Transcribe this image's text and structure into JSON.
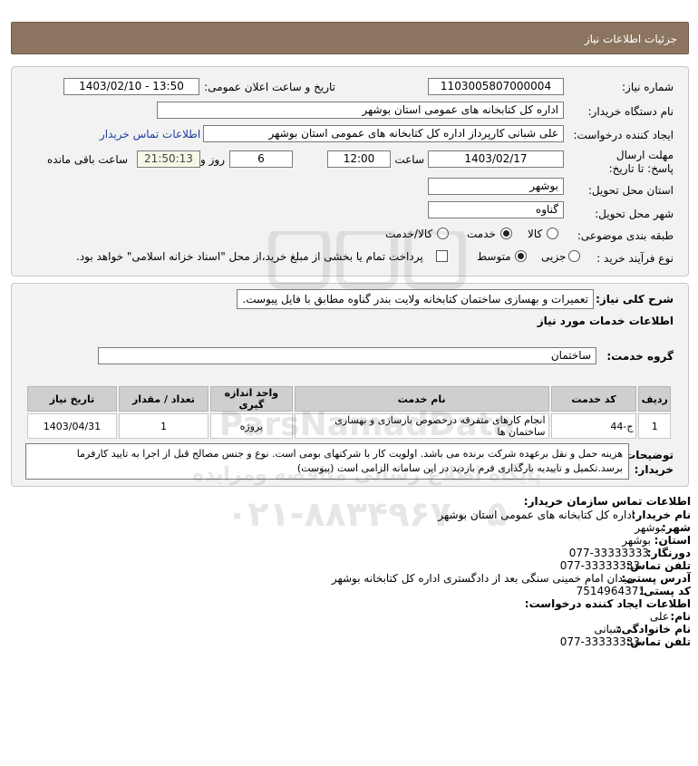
{
  "header": {
    "title": "جزئیات اطلاعات نیاز"
  },
  "form": {
    "need_number_label": "شماره نیاز:",
    "need_number": "1103005807000004",
    "announce_label": "تاریخ و ساعت اعلان عمومی:",
    "announce_value": "1403/02/10 - 13:50",
    "buyer_org_label": "نام دستگاه خریدار:",
    "buyer_org": "اداره کل کتابخانه های عمومی استان بوشهر",
    "creator_label": "ایجاد کننده درخواست:",
    "creator": "علی شبانی کارپرداز اداره کل کتابخانه های عمومی استان بوشهر",
    "contact_link": "اطلاعات تماس خریدار",
    "deadline_label": "مهلت ارسال پاسخ: تا تاریخ:",
    "deadline_date": "1403/02/17",
    "time_label": "ساعت",
    "deadline_time": "12:00",
    "days_value": "6",
    "days_label": "روز و",
    "remaining_time": "21:50:13",
    "remaining_label": "ساعت باقی مانده",
    "province_label": "استان محل تحویل:",
    "province": "بوشهر",
    "city_label": "شهر محل تحویل:",
    "city": "گناوه",
    "category_label": "طبقه بندی موضوعی:",
    "category_options": [
      "کالا",
      "خدمت",
      "کالا/خدمت"
    ],
    "category_selected": "خدمت",
    "process_label": "نوع فرآیند خرید :",
    "process_options": [
      "جزیی",
      "متوسط"
    ],
    "process_selected": "متوسط",
    "payment_note": "پرداخت تمام یا بخشی از مبلغ خرید،از محل \"اسناد خزانه اسلامی\" خواهد بود."
  },
  "need": {
    "summary_label": "شرح کلی نیاز:",
    "summary": "تعمیرات و بهسازی ساختمان کتابخانه ولایت بندر گناوه مطابق با فایل پیوست.",
    "services_title": "اطلاعات خدمات مورد نیاز",
    "service_group_label": "گروه خدمت:",
    "service_group": "ساختمان",
    "table_headers": [
      "ردیف",
      "کد خدمت",
      "نام خدمت",
      "واحد اندازه گیری",
      "تعداد / مقدار",
      "تاریخ نیاز"
    ],
    "table_rows": [
      [
        "1",
        "ج-44",
        "انجام کارهای متفرقه درخصوص بازسازی و بهسازی ساختمان ها",
        "پروژه",
        "1",
        "1403/04/31"
      ]
    ],
    "buyer_notes_label": "توضیحات خریدار:",
    "buyer_notes": "هزینه حمل و نقل برعهده شرکت برنده می باشد. اولویت کار با شرکتهای بومی است. نوع و جنس مصالح قبل از اجرا به تایید کارفرما برسد.تکمیل و تاییدیه بارگذاری فرم بازدید در این سامانه الزامی است (پیوست)"
  },
  "contact": {
    "org_title": "اطلاعات تماس سازمان خریدار:",
    "buyer_name_label": "نام خریدار:",
    "buyer_name": "اداره کل کتابخانه های عمومی استان بوشهر",
    "city_label": "شهر:",
    "city": "بوشهر",
    "province_label": "استان:",
    "province": "بوشهر",
    "fax_label": "دورنگار:",
    "fax": "077-33333333",
    "phone_label": "تلفن تماس:",
    "phone": "077-33333333",
    "address_label": "آدرس پستی:",
    "address": "میدان امام خمینی سنگی بعد از دادگستری اداره کل کتابخانه بوشهر",
    "postal_label": "کد پستی:",
    "postal": "7514964371",
    "creator_title": "اطلاعات ایجاد کننده درخواست:",
    "first_name_label": "نام:",
    "first_name": "علی",
    "last_name_label": "نام خانوادگی:",
    "last_name": "شبانی",
    "creator_phone_label": "تلفن تماس:",
    "creator_phone": "077-33333333"
  },
  "watermark": {
    "brand": "ParsNamadData",
    "tagline": "پایگاه اطلاع رسانی مناقصه ومزایده",
    "phone": "۰۲۱-۸۸۳۴۹۶۷۰-۵"
  }
}
